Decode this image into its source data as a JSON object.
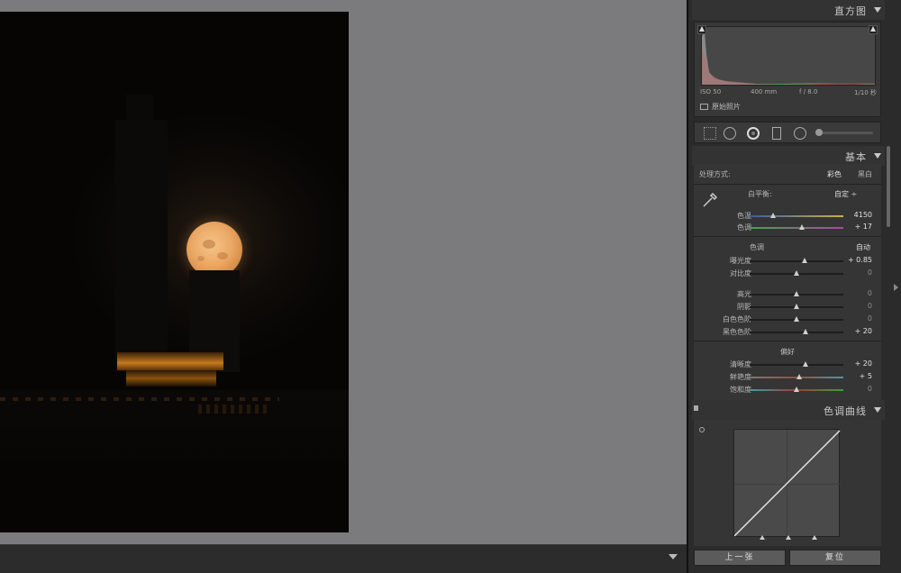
{
  "panels": {
    "histogram": {
      "title": "直方图"
    },
    "basic": {
      "title": "基本"
    },
    "tone_curve": {
      "title": "色调曲线"
    }
  },
  "exif": {
    "iso": "ISO 50",
    "focal": "400 mm",
    "aperture": "f / 8.0",
    "shutter": "1/10 秒"
  },
  "original_photo_label": "原始照片",
  "treatment": {
    "label": "处理方式:",
    "color": "彩色",
    "bw": "黑白"
  },
  "white_balance": {
    "label": "白平衡:",
    "value": "自定 ÷"
  },
  "sliders_wb": [
    {
      "label": "色温",
      "value": "4150",
      "level": 0.25
    },
    {
      "label": "色调",
      "value": "+ 17",
      "level": 0.56
    }
  ],
  "tone": {
    "title": "色调",
    "auto": "自动"
  },
  "sliders_tone1": [
    {
      "label": "曝光度",
      "value": "+ 0.85",
      "level": 0.59
    },
    {
      "label": "对比度",
      "value": "0",
      "level": 0.5
    }
  ],
  "sliders_tone2": [
    {
      "label": "高光",
      "value": "0",
      "level": 0.5
    },
    {
      "label": "阴影",
      "value": "0",
      "level": 0.5
    },
    {
      "label": "白色色阶",
      "value": "0",
      "level": 0.5
    },
    {
      "label": "黑色色阶",
      "value": "+ 20",
      "level": 0.6
    }
  ],
  "presence": {
    "title": "偏好"
  },
  "sliders_presence": [
    {
      "label": "清晰度",
      "value": "+ 20",
      "level": 0.6
    },
    {
      "label": "鲜艳度",
      "value": "+ 5",
      "level": 0.53
    },
    {
      "label": "饱和度",
      "value": "0",
      "level": 0.5
    }
  ],
  "buttons": {
    "previous": "上一张",
    "reset": "复位"
  }
}
